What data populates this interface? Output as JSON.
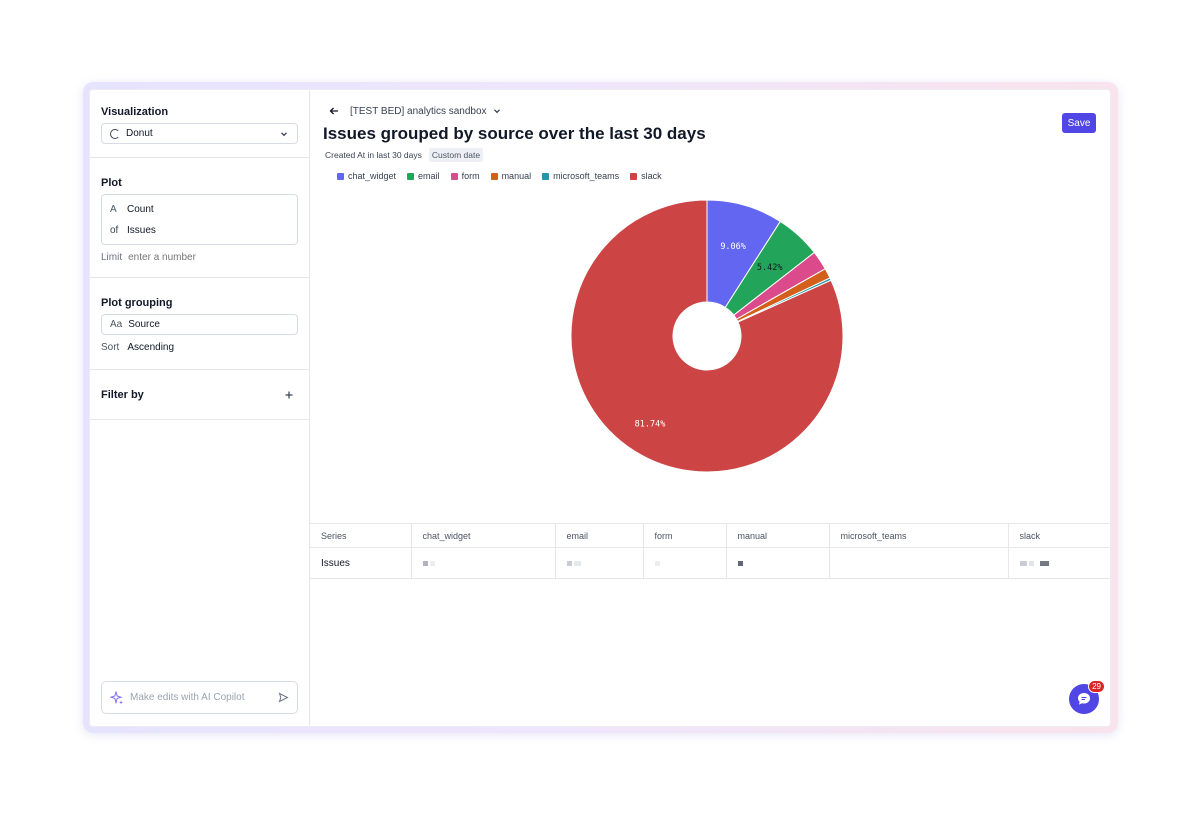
{
  "sidebar": {
    "visualization": {
      "title": "Visualization",
      "type_value": "Donut"
    },
    "plot": {
      "title": "Plot",
      "aggregate_badge": "A",
      "aggregate": "Count",
      "of_label": "of",
      "of_value": "Issues",
      "limit_label": "Limit",
      "limit_placeholder": "enter a number"
    },
    "grouping": {
      "title": "Plot grouping",
      "type_badge": "Aa",
      "field": "Source",
      "sort_label": "Sort",
      "sort_value": "Ascending"
    },
    "filter": {
      "title": "Filter by",
      "add_icon": "plus-icon"
    },
    "copilot": {
      "placeholder": "Make edits with AI Copilot"
    }
  },
  "header": {
    "breadcrumb": "[TEST BED] analytics sandbox",
    "title": "Issues grouped by source over the last 30 days",
    "filter_text": "Created At in last 30 days",
    "date_chip": "Custom date",
    "save_label": "Save"
  },
  "colors": {
    "accent": "#4f46e5"
  },
  "chart_data": {
    "type": "pie",
    "variant": "donut",
    "categories": [
      "chat_widget",
      "email",
      "form",
      "manual",
      "microsoft_teams",
      "slack"
    ],
    "values": [
      9.06,
      5.42,
      2.3,
      1.2,
      0.3,
      81.74
    ],
    "colors": [
      "#6366f1",
      "#22a55b",
      "#db4a8b",
      "#d35f1a",
      "#2596a8",
      "#cc4444"
    ],
    "data_labels": [
      "9.06%",
      "5.42%",
      "",
      "",
      "",
      "81.74%"
    ],
    "legend_position": "top-left"
  },
  "table": {
    "headers": [
      "Series",
      "chat_widget",
      "email",
      "form",
      "manual",
      "microsoft_teams",
      "slack"
    ],
    "rows": [
      {
        "series": "Issues"
      }
    ]
  },
  "chat_widget": {
    "badge_count": "29"
  }
}
